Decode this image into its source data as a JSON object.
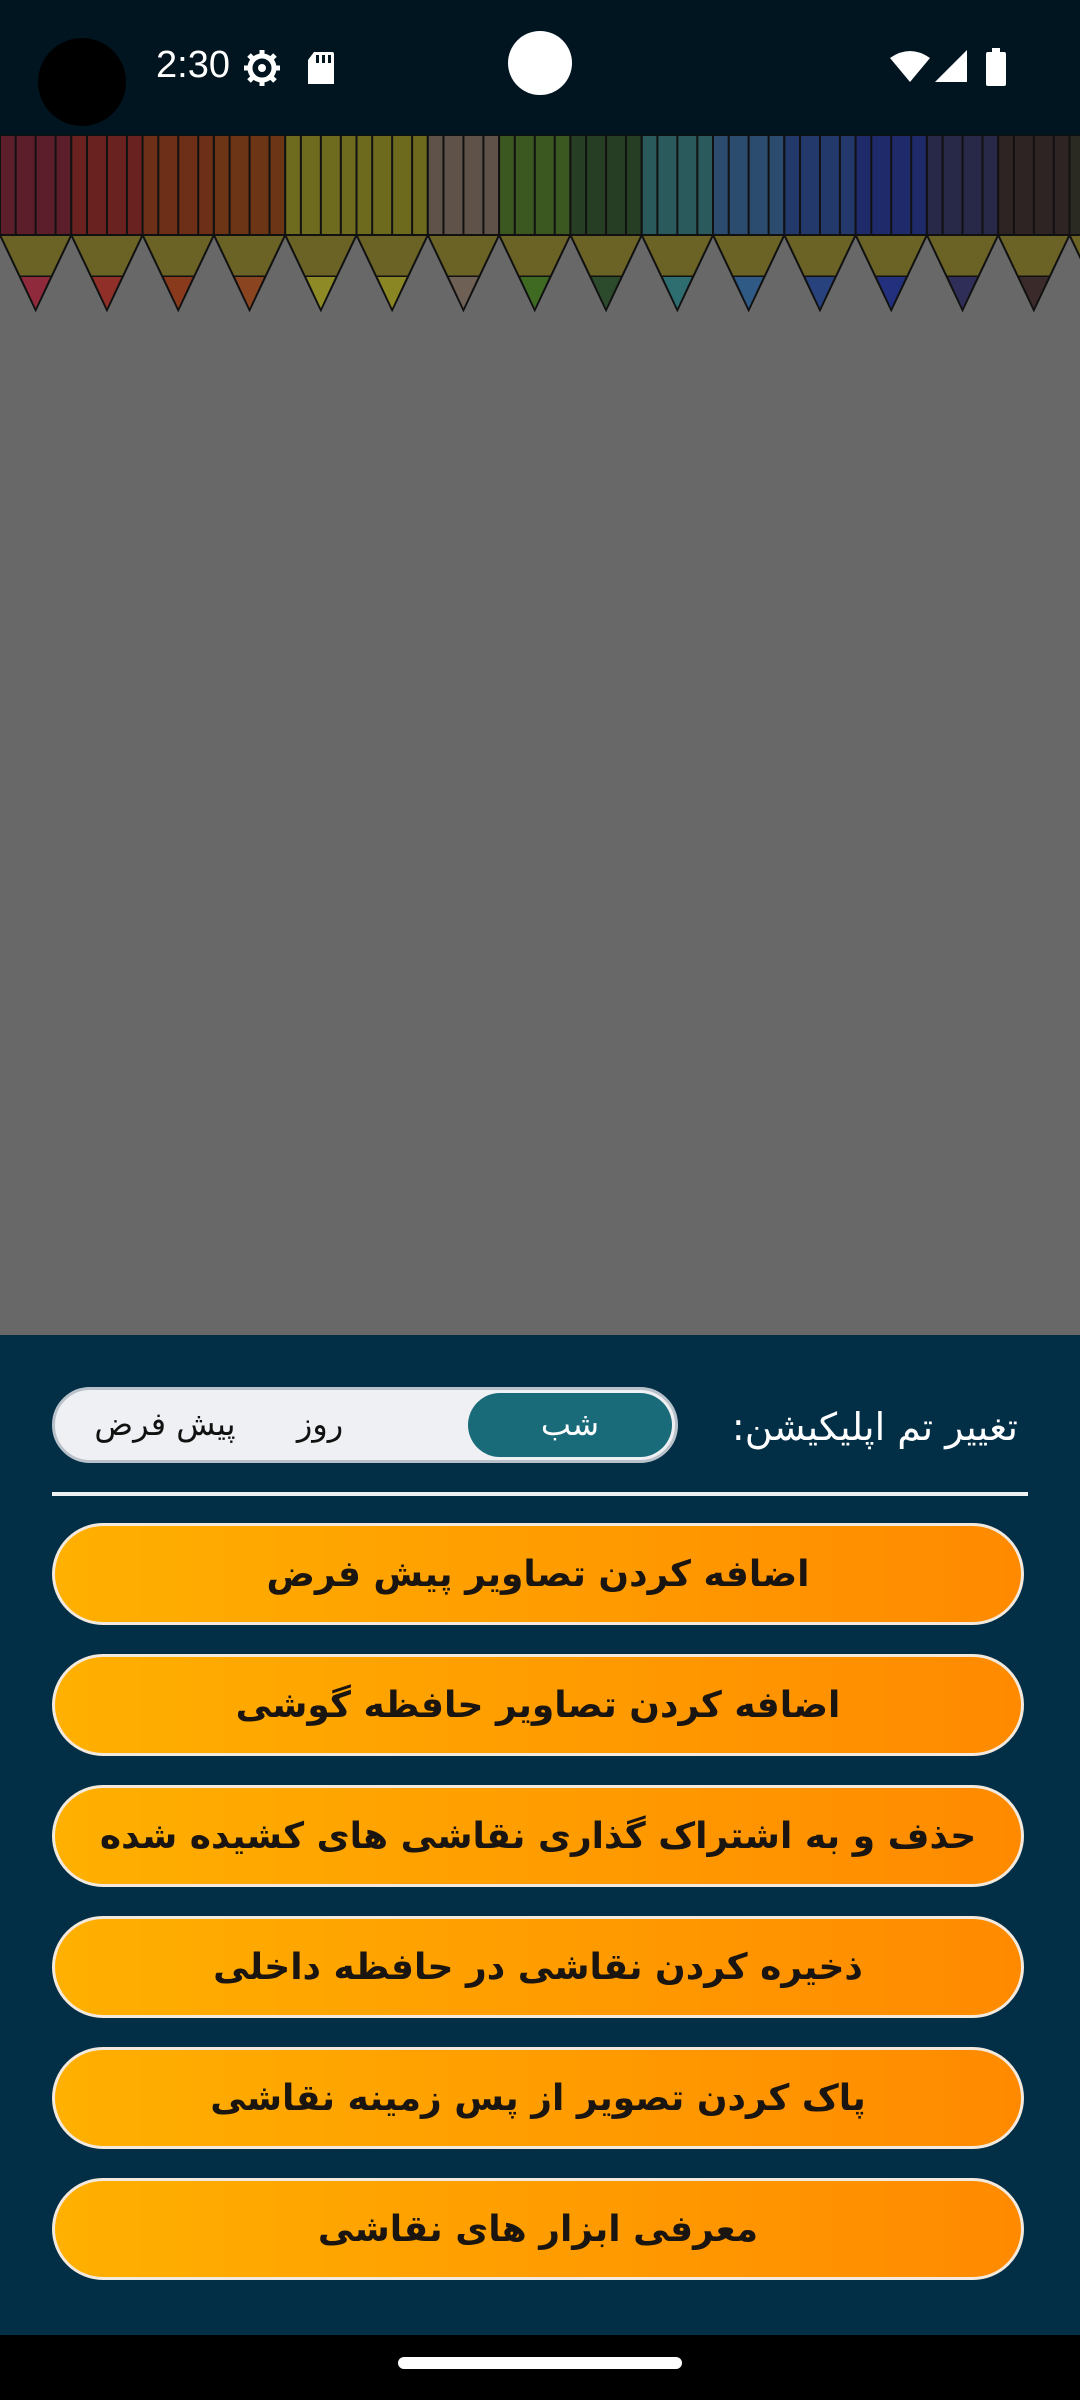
{
  "status_bar": {
    "time": "2:30",
    "icons": [
      "settings-gear-icon",
      "sd-card-icon",
      "wifi-icon",
      "cell-signal-icon",
      "battery-icon"
    ]
  },
  "pencil_colors": [
    {
      "body": "#5d1e2c",
      "tip": "#8e2a3c"
    },
    {
      "body": "#6a2220",
      "tip": "#8f2f28"
    },
    {
      "body": "#6e2f18",
      "tip": "#8a3a1c"
    },
    {
      "body": "#6b3516",
      "tip": "#8a4520"
    },
    {
      "body": "#6e6a1e",
      "tip": "#8e8a26"
    },
    {
      "body": "#6d6a1e",
      "tip": "#8b8624"
    },
    {
      "body": "#5f5248",
      "tip": "#6f6055"
    },
    {
      "body": "#3b5820",
      "tip": "#3f6a22"
    },
    {
      "body": "#263e24",
      "tip": "#2c4a2c"
    },
    {
      "body": "#2a5a5c",
      "tip": "#2e6e70"
    },
    {
      "body": "#2b4c6e",
      "tip": "#2f5a86"
    },
    {
      "body": "#23396c",
      "tip": "#28427e"
    },
    {
      "body": "#1e2a6a",
      "tip": "#22307e"
    },
    {
      "body": "#282848",
      "tip": "#2e2e58"
    },
    {
      "body": "#2e2424",
      "tip": "#3a2a2a"
    },
    {
      "body": "#2a2a22",
      "tip": "#333328"
    }
  ],
  "theme": {
    "label": "تغییر تم اپلیکیشن:",
    "options": {
      "night": "شب",
      "day": "روز",
      "default": "پیش فرض"
    },
    "selected": "شب"
  },
  "menu": {
    "buttons": [
      {
        "label": "اضافه کردن تصاویر پیش فرض"
      },
      {
        "label": "اضافه کردن تصاویر حافظه گوشی"
      },
      {
        "label": "حذف و به اشتراک گذاری نقاشی های کشیده شده"
      },
      {
        "label": "ذخیره کردن نقاشی در حافظه داخلی"
      },
      {
        "label": "پاک کردن تصویر از پس زمینه نقاشی"
      },
      {
        "label": "معرفی ابزار های نقاشی"
      }
    ]
  },
  "colors": {
    "status_bar_bg": "#011520",
    "canvas_bg": "#686868",
    "panel_bg": "#022e46",
    "toggle_active": "#196b7a",
    "button_gradient_start": "#ffb000",
    "button_gradient_end": "#ff8a00"
  }
}
